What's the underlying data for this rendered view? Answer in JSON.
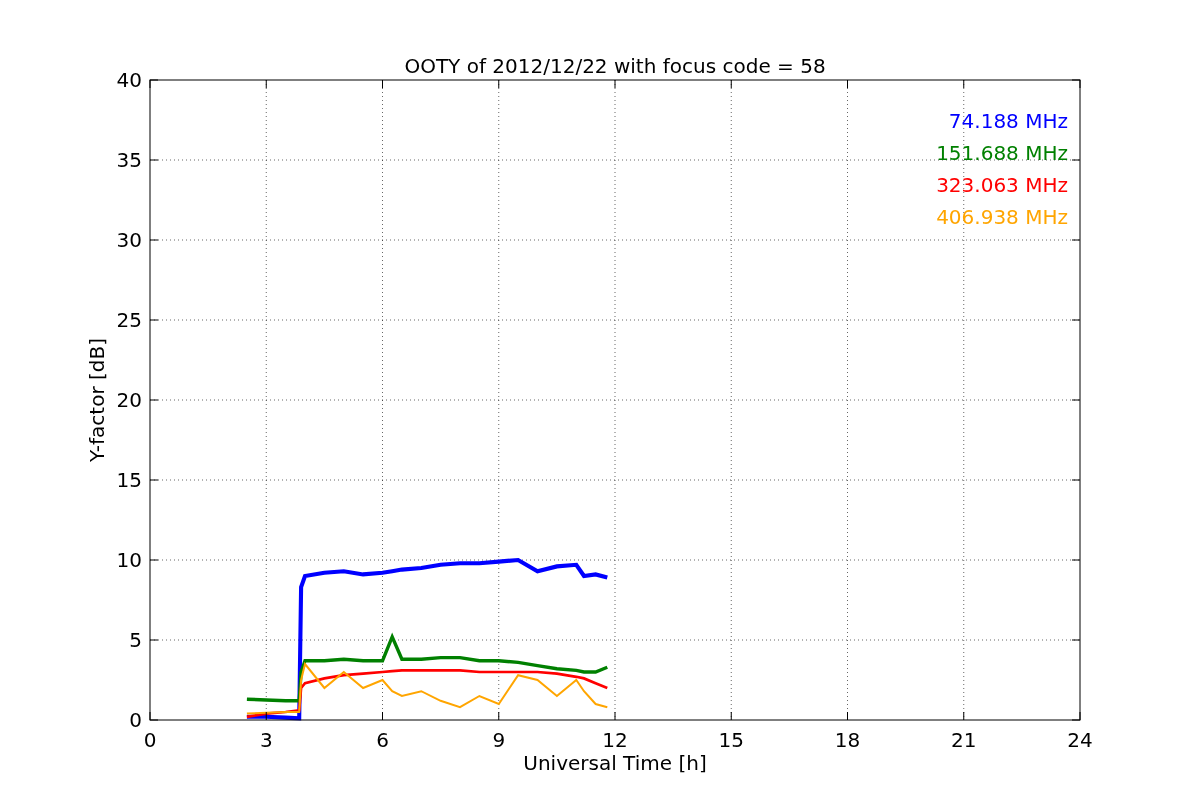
{
  "chart_data": {
    "type": "line",
    "title": "OOTY of 2012/12/22 with focus code = 58",
    "xlabel": "Universal Time [h]",
    "ylabel": "Y-factor [dB]",
    "x": [
      2.5,
      3,
      3.5,
      3.85,
      3.9,
      4,
      4.5,
      5,
      5.5,
      6,
      6.25,
      6.5,
      7,
      7.5,
      8,
      8.5,
      9,
      9.5,
      10,
      10.5,
      11,
      11.2,
      11.5,
      11.8
    ],
    "series": [
      {
        "name": "74.188 MHz",
        "color": "#0000ff",
        "values": [
          0.2,
          0.2,
          0.15,
          0.1,
          8.3,
          9.0,
          9.2,
          9.3,
          9.1,
          9.2,
          9.3,
          9.4,
          9.5,
          9.7,
          9.8,
          9.8,
          9.9,
          10.0,
          9.3,
          9.6,
          9.7,
          9.0,
          9.1,
          8.9
        ]
      },
      {
        "name": "151.688 MHz",
        "color": "#008000",
        "values": [
          1.3,
          1.25,
          1.2,
          1.2,
          3.0,
          3.7,
          3.7,
          3.8,
          3.7,
          3.7,
          5.2,
          3.8,
          3.8,
          3.9,
          3.9,
          3.7,
          3.7,
          3.6,
          3.4,
          3.2,
          3.1,
          3.0,
          3.0,
          3.3
        ]
      },
      {
        "name": "323.063 MHz",
        "color": "#ff0000",
        "values": [
          0.2,
          0.4,
          0.5,
          0.6,
          2.0,
          2.3,
          2.6,
          2.8,
          2.9,
          3.0,
          3.05,
          3.1,
          3.1,
          3.1,
          3.1,
          3.0,
          3.0,
          3.0,
          3.0,
          2.9,
          2.7,
          2.6,
          2.3,
          2.0
        ]
      },
      {
        "name": "406.938 MHz",
        "color": "#ffa500",
        "values": [
          0.4,
          0.45,
          0.5,
          0.5,
          2.5,
          3.5,
          2.0,
          3.0,
          2.0,
          2.5,
          1.8,
          1.5,
          1.8,
          1.2,
          0.8,
          1.5,
          1.0,
          2.8,
          2.5,
          1.5,
          2.5,
          1.8,
          1.0,
          0.8
        ]
      }
    ],
    "xlim": [
      0,
      24
    ],
    "ylim": [
      0,
      40
    ],
    "xticks": [
      0,
      3,
      6,
      9,
      12,
      15,
      18,
      21,
      24
    ],
    "yticks": [
      0,
      5,
      10,
      15,
      20,
      25,
      30,
      35,
      40
    ],
    "grid": true
  }
}
